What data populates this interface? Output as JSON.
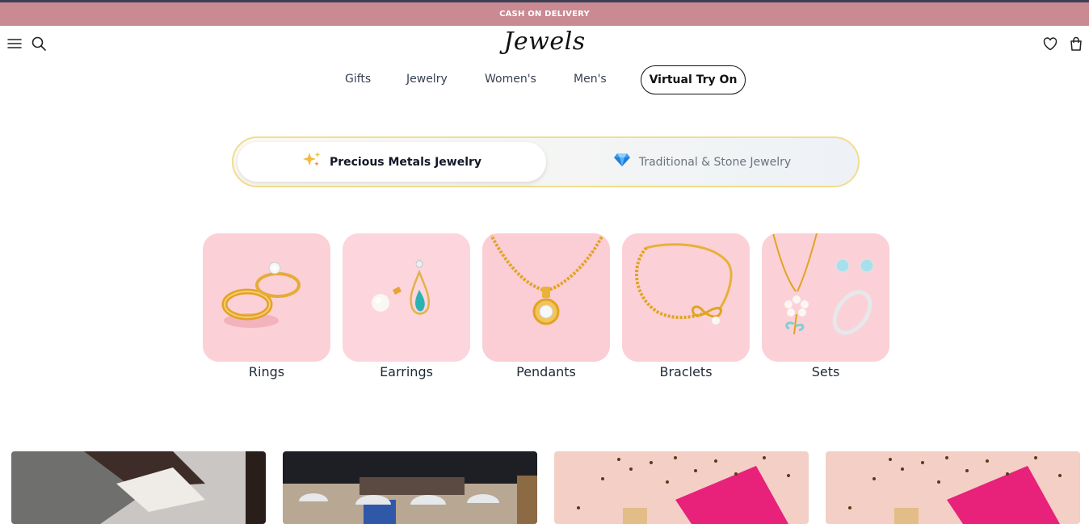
{
  "announcement": {
    "text": "CASH ON DELIVERY"
  },
  "header": {
    "logo": "Jewels",
    "icons": [
      "menu-icon",
      "search-icon",
      "heart-icon",
      "bag-icon"
    ]
  },
  "nav": {
    "items": [
      {
        "label": "Gifts"
      },
      {
        "label": "Jewelry"
      },
      {
        "label": "Women's"
      },
      {
        "label": "Men's"
      }
    ],
    "cta": "Virtual Try On"
  },
  "tabs": {
    "active": {
      "label": "Precious Metals Jewelry",
      "icon": "sparkles-icon"
    },
    "inactive": {
      "label": "Traditional & Stone Jewelry",
      "icon": "gem-icon"
    }
  },
  "categories": [
    {
      "label": "Rings"
    },
    {
      "label": "Earrings"
    },
    {
      "label": "Pendants"
    },
    {
      "label": "Braclets"
    },
    {
      "label": "Sets"
    }
  ],
  "colors": {
    "announcement_bg": "#c98a92",
    "category_bg": "#fbd1d7",
    "toggle_border": "#f3dc8e",
    "gold": "#e0a422"
  }
}
